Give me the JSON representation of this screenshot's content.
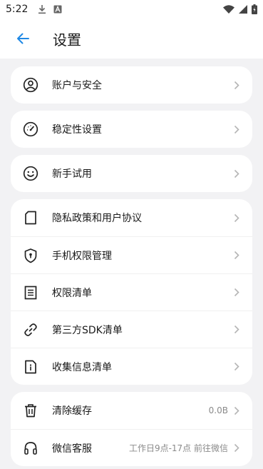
{
  "status_bar": {
    "time": "5:22"
  },
  "header": {
    "title": "设置"
  },
  "groups": [
    {
      "items": [
        {
          "label": "账户与安全",
          "icon": "account-icon"
        }
      ]
    },
    {
      "items": [
        {
          "label": "稳定性设置",
          "icon": "gauge-icon"
        }
      ]
    },
    {
      "items": [
        {
          "label": "新手试用",
          "icon": "smiley-icon"
        }
      ]
    },
    {
      "items": [
        {
          "label": "隐私政策和用户协议",
          "icon": "document-icon"
        },
        {
          "label": "手机权限管理",
          "icon": "shield-lock-icon"
        },
        {
          "label": "权限清单",
          "icon": "list-icon"
        },
        {
          "label": "第三方SDK清单",
          "icon": "link-icon"
        },
        {
          "label": "收集信息清单",
          "icon": "info-doc-icon"
        }
      ]
    },
    {
      "items": [
        {
          "label": "清除缓存",
          "value": "0.0B",
          "icon": "trash-icon"
        },
        {
          "label": "微信客服",
          "value": "工作日9点-17点 前往微信",
          "icon": "headset-icon"
        }
      ]
    }
  ]
}
